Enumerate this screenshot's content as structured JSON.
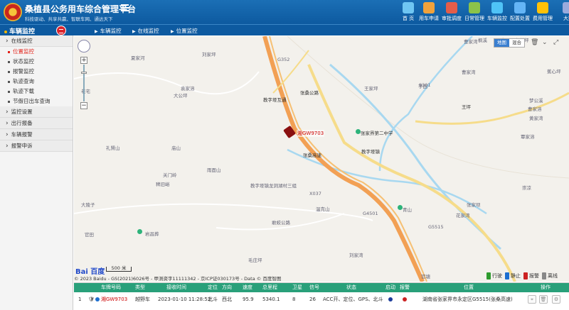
{
  "header": {
    "title": "桑植县公务用车综合管理平台",
    "slogan": "科技驱动、共享共赢、智联车网、通达天下",
    "nav": [
      {
        "label": "首 页",
        "icon": "home-icon",
        "color": "#6fc6f2"
      },
      {
        "label": "用车申请",
        "icon": "car-request-icon",
        "color": "#f0a23b"
      },
      {
        "label": "审批调度",
        "icon": "approval-icon",
        "color": "#e35d4a"
      },
      {
        "label": "日常管理",
        "icon": "daily-manage-icon",
        "color": "#8bc34a"
      },
      {
        "label": "车辆监控",
        "icon": "vehicle-monitor-icon",
        "color": "#4fc3f7"
      },
      {
        "label": "配置处置",
        "icon": "config-icon",
        "color": "#64b5f6"
      },
      {
        "label": "费用管理",
        "icon": "cost-icon",
        "color": "#ffc107"
      },
      {
        "label": "大数",
        "icon": "bigdata-icon",
        "color": "#9ad"
      }
    ]
  },
  "subbar": {
    "section": "车辆监控",
    "breadcrumbs": [
      "车辆监控",
      "在线监控",
      "位置监控"
    ]
  },
  "sidebar": {
    "groups": [
      {
        "label": "在线监控",
        "items": [
          {
            "label": "位置监控",
            "active": true
          },
          {
            "label": "状态监控",
            "active": false
          },
          {
            "label": "报警监控",
            "active": false
          },
          {
            "label": "轨迹查询",
            "active": false
          },
          {
            "label": "轨迹下载",
            "active": false
          },
          {
            "label": "节假日出车查询",
            "active": false
          }
        ]
      },
      {
        "label": "监控设置",
        "items": []
      },
      {
        "label": "出行报备",
        "items": []
      },
      {
        "label": "车辆报警",
        "items": []
      },
      {
        "label": "报警申诉",
        "items": []
      }
    ]
  },
  "map": {
    "types": [
      "地图",
      "混合"
    ],
    "active_type": "地图",
    "scale": "500 米",
    "copyright": "© 2023 Baidu - GS(2021)6026号 - 甲测资字11111342 - 京ICP证030173号 - Data © 百度智图",
    "logo": "Bai 百度",
    "vehicle_plate": "湘GW9703",
    "labels": [
      "刘家坪",
      "夏家河",
      "曹家湾",
      "袁家溶",
      "芋园",
      "老宅",
      "大公坪",
      "王家坪",
      "梦公溪",
      "枫溪",
      "九丝坪",
      "曹家湾",
      "曹家溶",
      "黄家湾",
      "王坪",
      "教字垭互通",
      "张桑公路",
      "张桑高速",
      "教字垭镇",
      "张家界第二中学",
      "礼賢山",
      "庙山",
      "关门岭",
      "雨面山",
      "稗旧峪",
      "教字垭镇龙洞湖村三组",
      "温克山",
      "大陵子",
      "官田",
      "青山",
      "敢蛟公路",
      "岩昌葬",
      "崇凉",
      "张家坝",
      "花家湾",
      "毛庄坪",
      "刘家湾",
      "官塘",
      "覃家溶",
      "蕉心坪",
      "寨子",
      "G5515",
      "G4501",
      "G352",
      "S301",
      "X037"
    ],
    "legend": [
      {
        "label": "行驶",
        "color": "#2e9b2e"
      },
      {
        "label": "静止",
        "color": "#1c6fd0"
      },
      {
        "label": "报警",
        "color": "#c22"
      },
      {
        "label": "离线",
        "color": "#888"
      }
    ]
  },
  "table": {
    "headers": [
      "车牌号码",
      "类型",
      "接收时间",
      "定位",
      "方向",
      "速度",
      "总里程",
      "卫星",
      "信号",
      "状态",
      "启动",
      "报警",
      "位置",
      "操作"
    ],
    "rows": [
      {
        "index": "1",
        "plate": "湘GW9703",
        "type": "越野车",
        "time": "2023-01-10 11:28:52",
        "locate": "北斗",
        "direction": "西北",
        "speed": "95.9",
        "mileage": "5340.1",
        "satellites": "8",
        "signal": "26",
        "status": "ACC开、定位、GPS、北斗",
        "start_color": "#1c3c9b",
        "alarm_color": "#c22",
        "location": "湖南省张家界市永定区G5515(张桑高速)"
      }
    ]
  }
}
